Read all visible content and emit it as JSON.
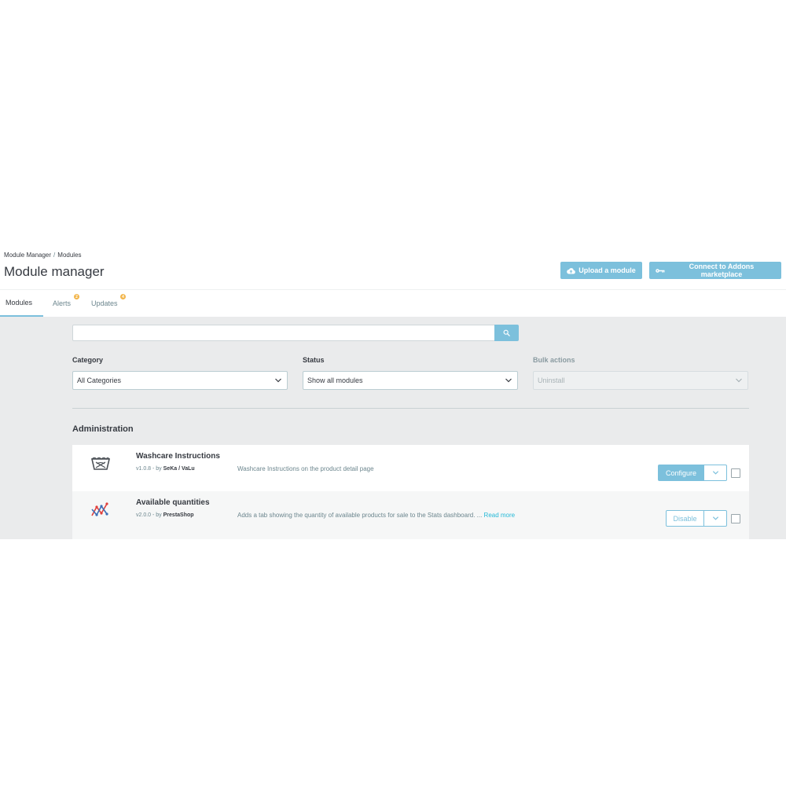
{
  "breadcrumb": {
    "root": "Module Manager",
    "separator": "/",
    "current": "Modules"
  },
  "page_title": "Module manager",
  "toolbar": {
    "upload_label": "Upload a module",
    "upload_icon": "cloud-upload-icon",
    "connect_label": "Connect to Addons marketplace",
    "connect_icon": "key-icon"
  },
  "tabs": [
    {
      "label": "Modules",
      "active": true
    },
    {
      "label": "Alerts",
      "badge": "2"
    },
    {
      "label": "Updates",
      "badge": "4"
    }
  ],
  "search": {
    "placeholder": "",
    "button_icon": "search-icon"
  },
  "filters": {
    "category": {
      "label": "Category",
      "value": "All Categories"
    },
    "status": {
      "label": "Status",
      "value": "Show all modules"
    },
    "bulk": {
      "label": "Bulk actions",
      "value": "Uninstall",
      "disabled": true
    }
  },
  "section": {
    "title": "Administration"
  },
  "modules": [
    {
      "name": "Washcare Instructions",
      "version": "v1.0.8 - by",
      "author": "SeKa / VaLu",
      "description": "Washcare Instructions on the product detail page",
      "action": "Configure",
      "icon": "washcare-basin-icon"
    },
    {
      "name": "Available quantities",
      "version": "v2.0.0 - by",
      "author": "PrestaShop",
      "description": "Adds a tab showing the quantity of available products for sale to the Stats dashboard. ...",
      "read_more": "Read more",
      "action": "Disable",
      "icon": "stats-line-chart-icon"
    }
  ],
  "colors": {
    "accent": "#7cc0dc",
    "badge": "#f2b54a",
    "link": "#25b9d7",
    "background": "#eaebec"
  }
}
